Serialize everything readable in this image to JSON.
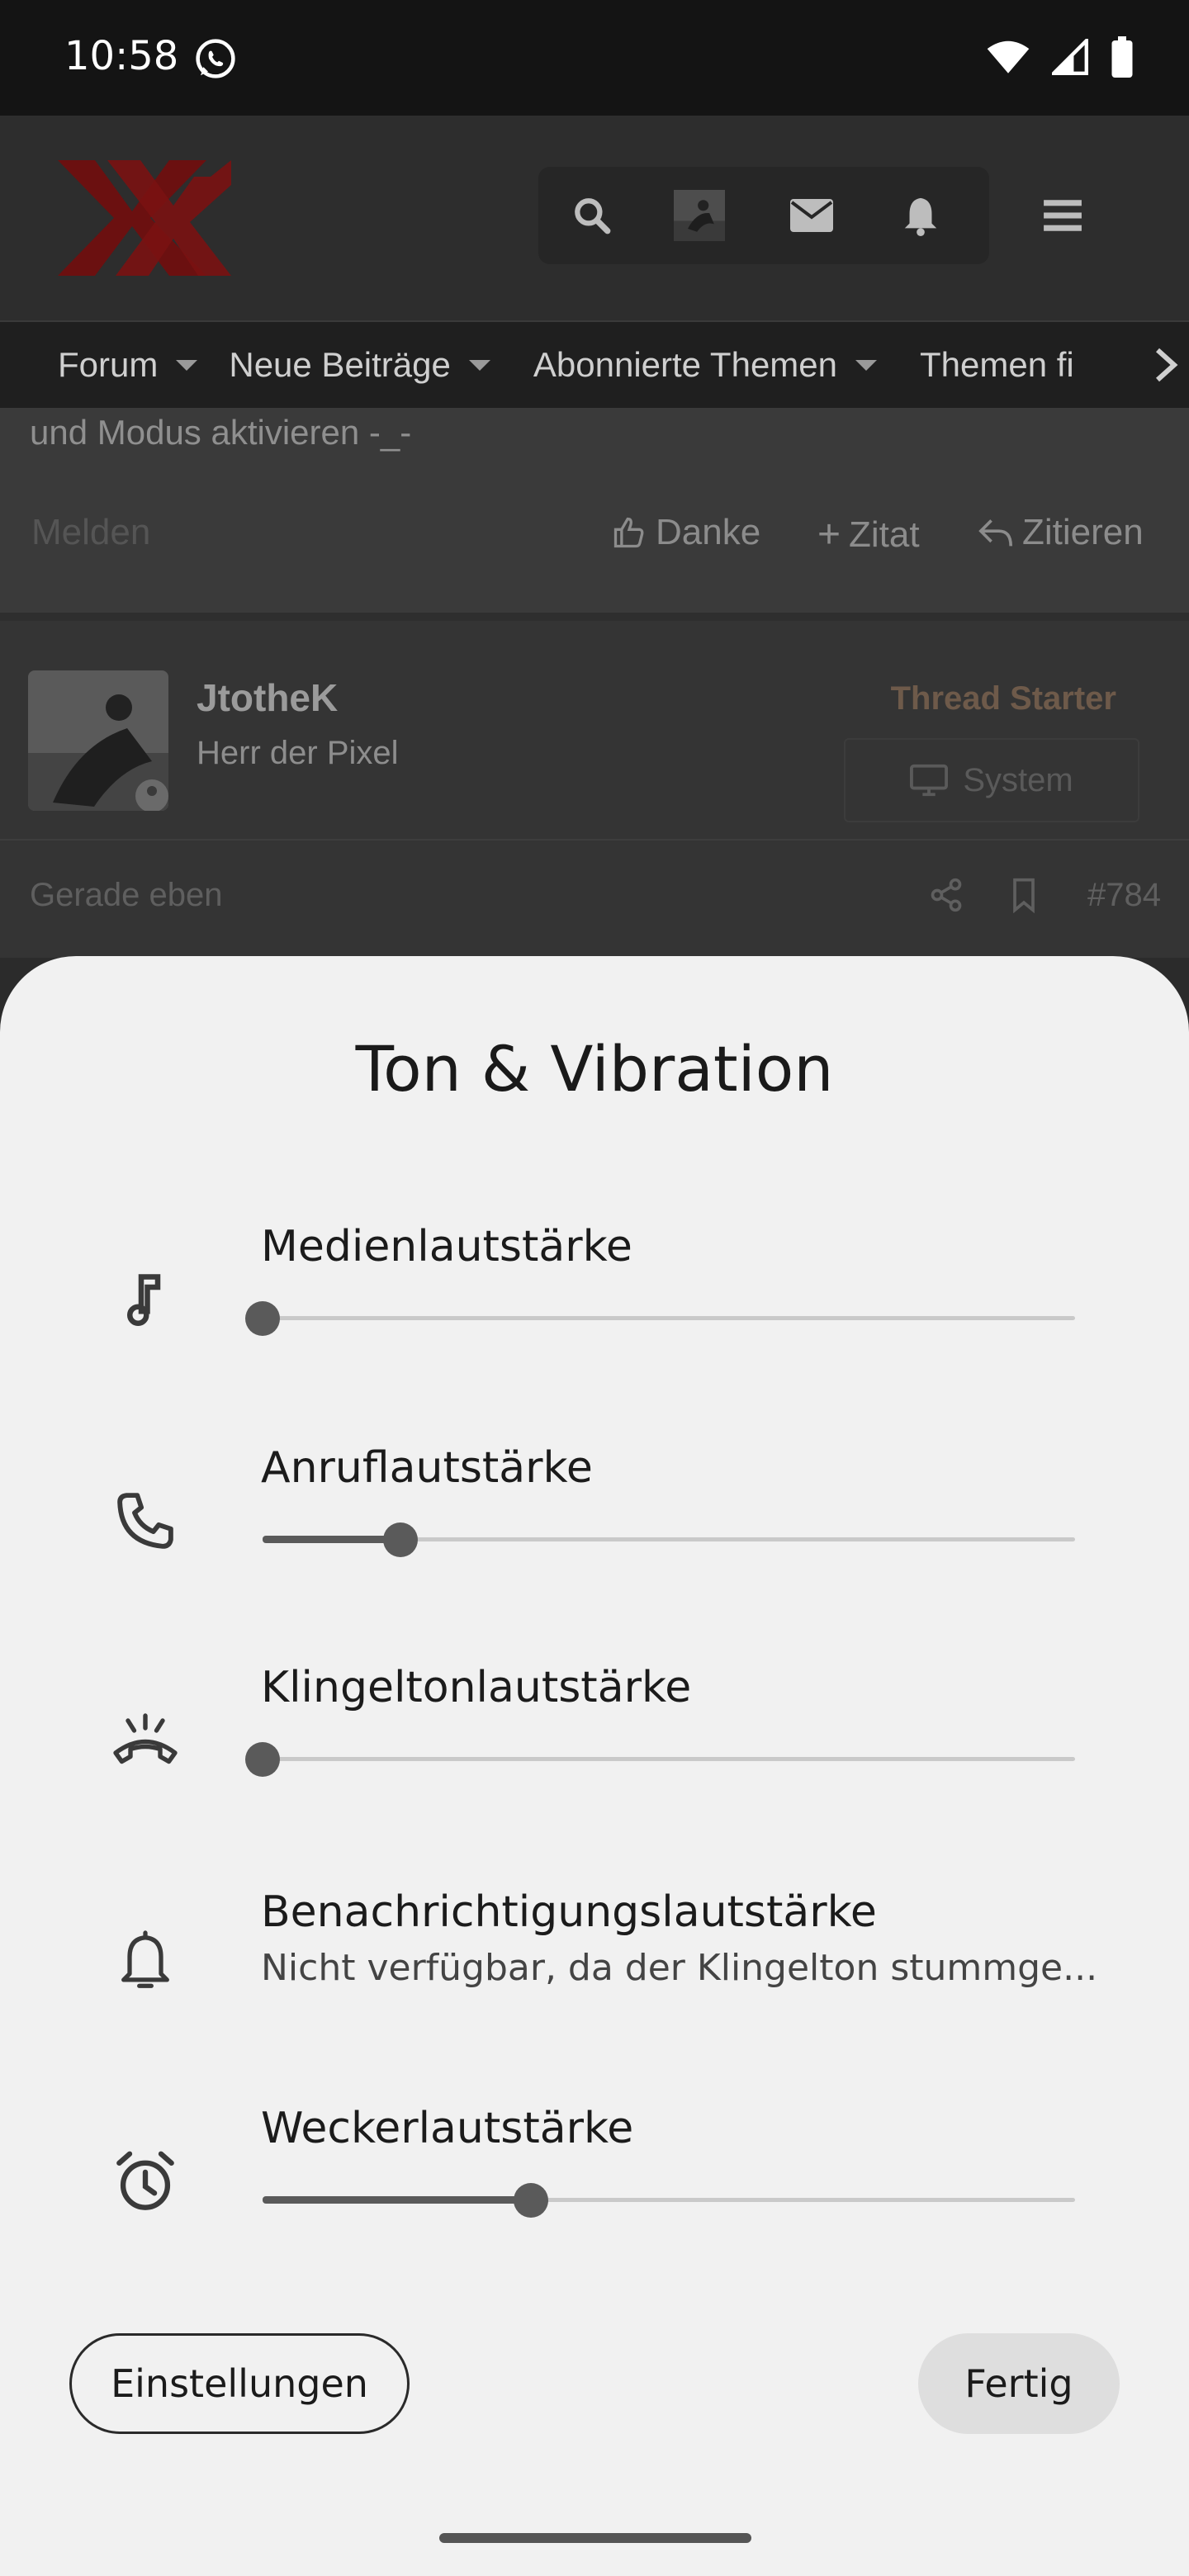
{
  "status_bar": {
    "time": "10:58"
  },
  "forum": {
    "nav": [
      "Forum",
      "Neue Beiträge",
      "Abonnierte Themen",
      "Themen fi"
    ],
    "post_text": "und Modus aktivieren -_-",
    "actions": {
      "report": "Melden",
      "thanks": "Danke",
      "quote": "Zitat",
      "cite": "Zitieren"
    },
    "author": {
      "name": "JtotheK",
      "title": "Herr der Pixel",
      "badge": "Thread Starter",
      "system_button": "System"
    },
    "meta": {
      "time": "Gerade eben",
      "post_number": "#784"
    }
  },
  "sheet": {
    "title": "Ton & Vibration",
    "rows": [
      {
        "label": "Medienlautstärke",
        "icon": "music-note-icon",
        "level_percent": 0
      },
      {
        "label": "Anruflautstärke",
        "icon": "phone-icon",
        "level_percent": 17
      },
      {
        "label": "Klingeltonlautstärke",
        "icon": "ringer-off-icon",
        "level_percent": 0
      },
      {
        "label": "Benachrichtigungslautstärke",
        "icon": "bell-icon",
        "subtitle": "Nicht verfügbar, da der Klingelton stummge..."
      },
      {
        "label": "Weckerlautstärke",
        "icon": "alarm-clock-icon",
        "level_percent": 33
      }
    ],
    "buttons": {
      "settings": "Einstellungen",
      "done": "Fertig"
    }
  },
  "colors": {
    "sheet_background": "#f1f1f1",
    "slider_active": "#5a5a5a",
    "slider_track": "#c9c9c9",
    "status_bar": "#141414",
    "logo_red": "#8a1414"
  }
}
